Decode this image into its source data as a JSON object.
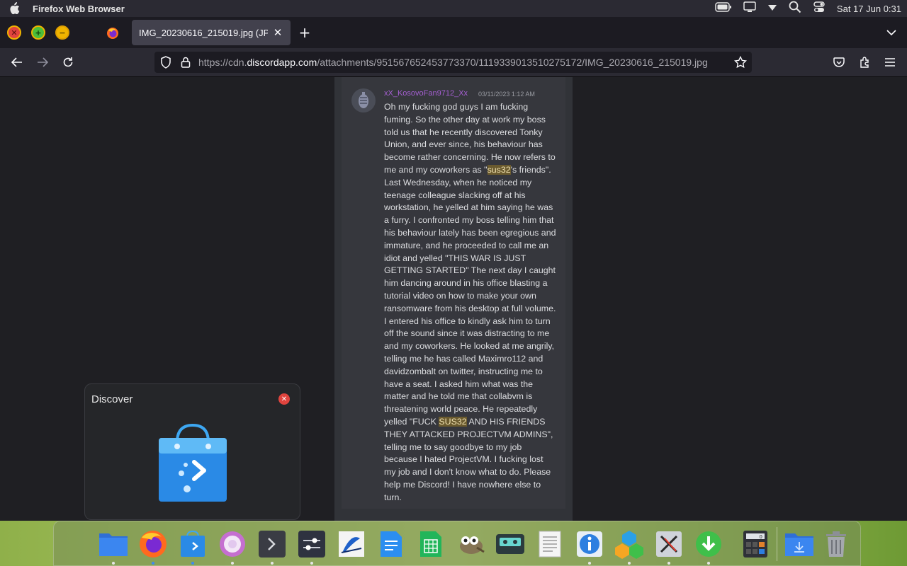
{
  "system_bar": {
    "app_name": "Firefox Web Browser",
    "clock": "Sat 17 Jun  0:31"
  },
  "browser": {
    "tab": {
      "title": "IMG_20230616_215019.jpg (JPEG",
      "close": "✕"
    },
    "new_tab": "+",
    "url": {
      "prefix": "https://cdn.",
      "host": "discordapp.com",
      "path": "/attachments/951567652453773370/1119339013510275172/IMG_20230616_215019.jpg"
    }
  },
  "message": {
    "username": "xX_KosovoFan9712_Xx",
    "timestamp": "03/11/2023 1:12 AM",
    "part1": "Oh my fucking god guys I am fucking fuming. So the other day at work my boss told us that he recently discovered Tonky Union, and ever since, his behaviour has become rather concerning. He now refers to me and my coworkers as \"",
    "hl1": "sus32",
    "part2": "'s friends\". Last Wednesday, when he noticed my teenage colleague slacking off at his workstation, he yelled at him saying he was a furry. I confronted my boss telling him that his behaviour lately has been egregious and immature, and he proceeded to call me an idiot and yelled \"THIS WAR IS JUST GETTING STARTED\" The next day I caught him dancing around in his office blasting a tutorial video on how to make your own ransomware from his desktop at full volume. I entered his office to kindly ask him to turn off the sound since it was distracting to me and my coworkers. He looked at me angrily, telling me he has called Maximro112 and davidzombalt on twitter, instructing me to have a seat. I asked him what was the matter and he told me that collabvm is threatening world peace. He repeatedly yelled \"FUCK ",
    "hl2": "SUS32",
    "part3": " AND HIS FRIENDS THEY ATTACKED PROJECTVM ADMINS\", telling me to say goodbye to my job because I hated ProjectVM. I fucking lost my job and I don't know what to do. Please help me Discord! I have nowhere else to turn."
  },
  "discover_popup": {
    "title": "Discover"
  },
  "dock": {
    "items": [
      "files-icon",
      "firefox-icon",
      "discover-icon",
      "camera-app-icon",
      "terminal-icon",
      "settings-icon",
      "inkscape-icon",
      "document-icon",
      "spreadsheet-icon",
      "gimp-icon",
      "cassette-icon",
      "text-editor-icon",
      "info-icon",
      "package-icon",
      "x-app-icon",
      "download-icon",
      "calculator-icon",
      "downloads-folder-icon",
      "trash-icon"
    ]
  },
  "colors": {
    "accent": "#a55fd2",
    "highlight": "#6a5a2e"
  }
}
